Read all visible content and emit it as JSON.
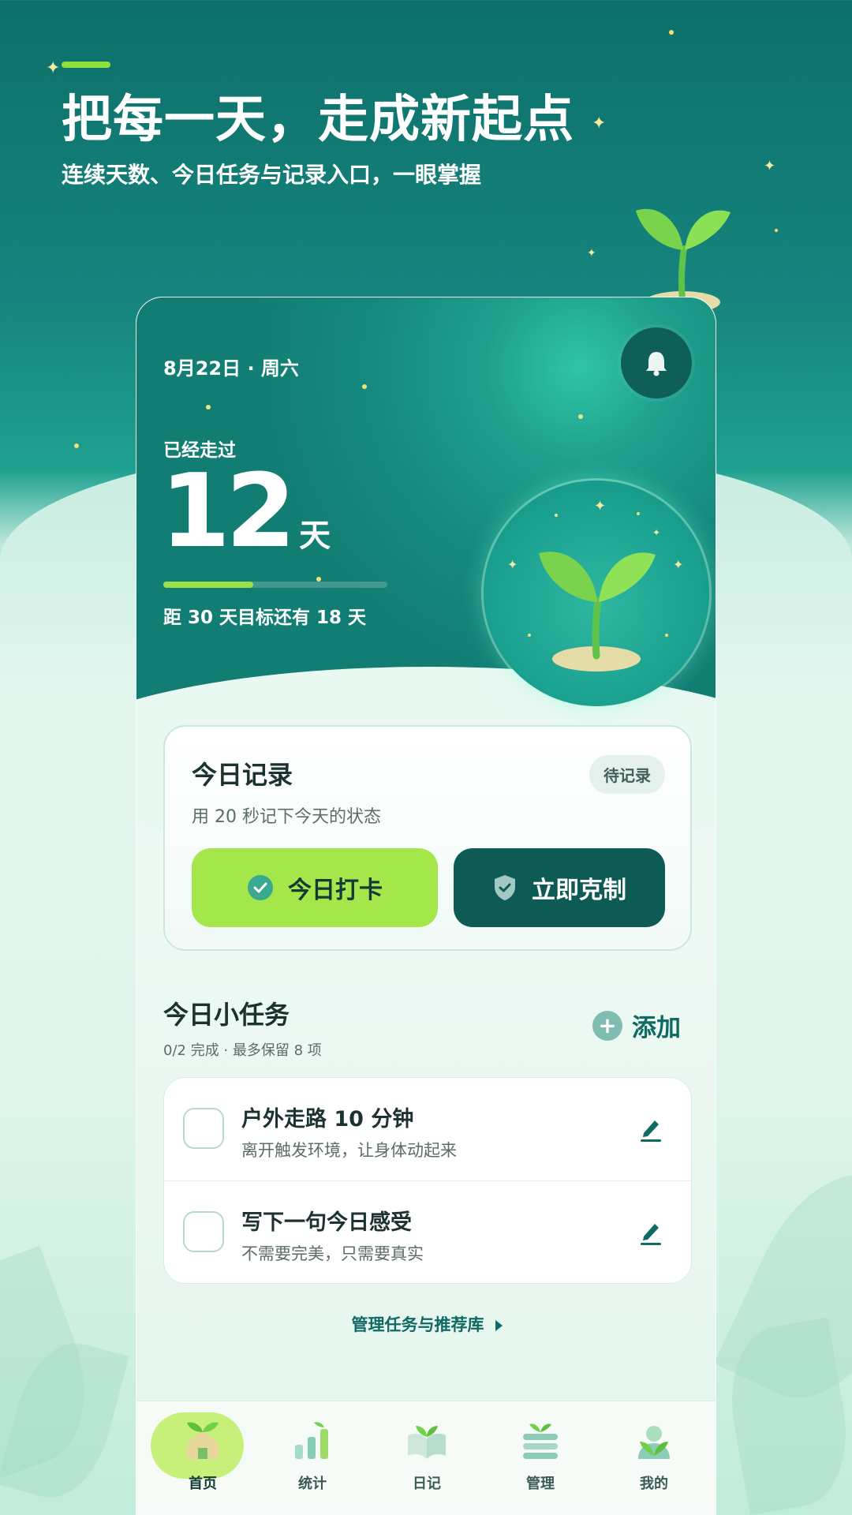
{
  "headline": "把每一天，走成新起点",
  "subheadline": "连续天数、今日任务与记录入口，一眼掌握",
  "hero": {
    "date": "8月22日 · 周六",
    "walked_label": "已经走过",
    "days": "12",
    "days_unit": "天",
    "progress_fraction": 0.4,
    "goal_text": "距 30 天目标还有 18 天"
  },
  "record": {
    "title": "今日记录",
    "status": "待记录",
    "desc": "用 20 秒记下今天的状态",
    "checkin_label": "今日打卡",
    "resist_label": "立即克制"
  },
  "tasks": {
    "title": "今日小任务",
    "meta": "0/2 完成 · 最多保留 8 项",
    "add_label": "添加",
    "items": [
      {
        "name": "户外走路 10 分钟",
        "desc": "离开触发环境，让身体动起来"
      },
      {
        "name": "写下一句今日感受",
        "desc": "不需要完美，只需要真实"
      }
    ],
    "manage_link": "管理任务与推荐库"
  },
  "tabs": [
    {
      "label": "首页",
      "icon": "sprout-house-icon",
      "active": true
    },
    {
      "label": "统计",
      "icon": "bar-chart-icon"
    },
    {
      "label": "日记",
      "icon": "book-icon"
    },
    {
      "label": "管理",
      "icon": "list-sprout-icon"
    },
    {
      "label": "我的",
      "icon": "person-sprout-icon"
    }
  ],
  "colors": {
    "accent_green": "#a4e74a",
    "dark_teal": "#0e5b56",
    "hero_teal": "#158a7e"
  }
}
